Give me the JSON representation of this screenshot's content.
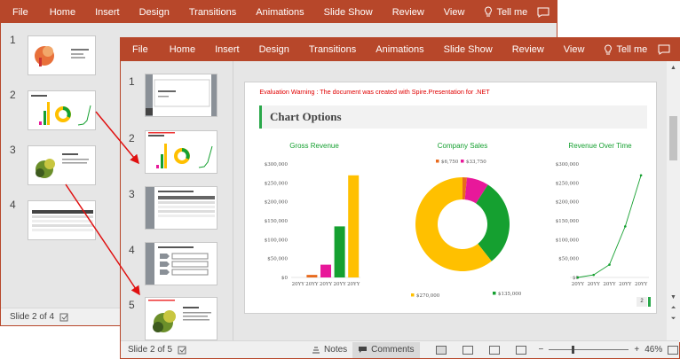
{
  "ribbon_tabs": [
    "File",
    "Home",
    "Insert",
    "Design",
    "Transitions",
    "Animations",
    "Slide Show",
    "Review",
    "View"
  ],
  "tell_me": "Tell me",
  "back": {
    "slides": [
      {
        "num": "1"
      },
      {
        "num": "2"
      },
      {
        "num": "3"
      },
      {
        "num": "4"
      }
    ],
    "status": "Slide 2 of 4"
  },
  "front": {
    "slides": [
      {
        "num": "1"
      },
      {
        "num": "2"
      },
      {
        "num": "3"
      },
      {
        "num": "4"
      },
      {
        "num": "5"
      }
    ],
    "status": "Slide 2 of 5",
    "notes_label": "Notes",
    "comments_label": "Comments",
    "zoom": "46%"
  },
  "slide": {
    "warning": "Evaluation Warning : The document was created with  Spire.Presentation for .NET",
    "title": "Chart Options",
    "page_number": "2"
  },
  "colors": {
    "ribbon": "#b7472a",
    "green": "#2aa84a",
    "yellow": "#ffc000",
    "magenta": "#e8189a",
    "orange": "#e86a1e",
    "chart_green": "#15a030"
  },
  "chart_data": [
    {
      "type": "bar",
      "title": "Gross Revenue",
      "categories": [
        "20YY",
        "20YY",
        "20YY",
        "20YY",
        "20YY"
      ],
      "values": [
        0,
        6750,
        33750,
        135000,
        270000
      ],
      "ylim": [
        0,
        300000
      ],
      "yticks": [
        "$0",
        "$50,000",
        "$100,000",
        "$150,000",
        "$200,000",
        "$250,000",
        "$300,000"
      ],
      "colors": [
        "#15a030",
        "#e86a1e",
        "#e8189a",
        "#15a030",
        "#ffc000"
      ]
    },
    {
      "type": "pie",
      "title": "Company Sales",
      "values": [
        6750,
        33750,
        135000,
        270000
      ],
      "labels": [
        "$6,750",
        "$33,750",
        "$135,000",
        "$270,000"
      ],
      "colors": [
        "#e86a1e",
        "#e8189a",
        "#15a030",
        "#ffc000"
      ]
    },
    {
      "type": "line",
      "title": "Revenue Over Time",
      "categories": [
        "20YY",
        "20YY",
        "20YY",
        "20YY",
        "20YY"
      ],
      "values": [
        0,
        6750,
        33750,
        135000,
        270000
      ],
      "ylim": [
        0,
        300000
      ],
      "yticks": [
        "$0",
        "$50,000",
        "$100,000",
        "$150,000",
        "$200,000",
        "$250,000",
        "$300,000"
      ],
      "color": "#15a030"
    }
  ]
}
